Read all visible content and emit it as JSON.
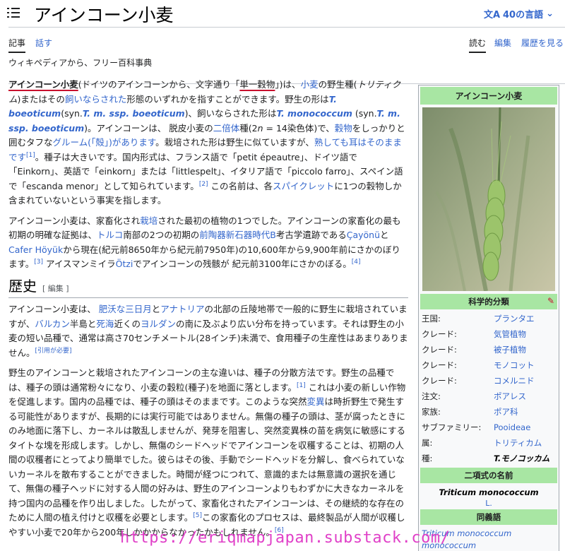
{
  "header": {
    "title": "アインコーン小麦",
    "lang_label": "40の言語",
    "lang_icon": "translate-icon"
  },
  "tabs": {
    "article": "記事",
    "talk": "話す",
    "read": "読む",
    "edit": "編集",
    "history": "履歴を見る"
  },
  "tagline": "ウィキペディアから、フリー百科事典",
  "intro": {
    "p1": [
      {
        "t": "アインコーン小麦",
        "s": "bold-red"
      },
      {
        "t": "(ドイツのアインコーンから、文字通り「"
      },
      {
        "t": "単一穀物",
        "s": "red"
      },
      {
        "t": "」)は、"
      },
      {
        "t": "小麦",
        "s": "link"
      },
      {
        "t": "の野生種("
      },
      {
        "t": "トリティクム",
        "s": "ital"
      },
      {
        "t": ")またはその"
      },
      {
        "t": "飼いならされた",
        "s": "link"
      },
      {
        "t": "形態のいずれかを指すことができます。野生の形は"
      },
      {
        "t": "T. boeoticum",
        "s": "bl"
      },
      {
        "t": "(syn."
      },
      {
        "t": "T. m. ssp. boeoticum",
        "s": "bl"
      },
      {
        "t": ")、飼いならされた形は"
      },
      {
        "t": "T. monococcum",
        "s": "bl"
      },
      {
        "t": " (syn."
      },
      {
        "t": "T. m. ssp. boeoticum",
        "s": "bl"
      },
      {
        "t": ")。アインコーンは、 脱皮小麦の"
      },
      {
        "t": "二倍体",
        "s": "link"
      },
      {
        "t": "種(2"
      },
      {
        "t": "n",
        "s": "ital"
      },
      {
        "t": " = 14染色体)で、"
      },
      {
        "t": "穀物",
        "s": "link"
      },
      {
        "t": "をしっかりと囲むタフな"
      },
      {
        "t": "グルーム(「殻」)があります",
        "s": "link"
      },
      {
        "t": "。栽培された形は野生に似ていますが、"
      },
      {
        "t": "熟しても耳はそのままです",
        "s": "link"
      },
      {
        "t": "[1]",
        "s": "sup"
      },
      {
        "t": "。種子は大きいです。国内形式は、フランス語で「petit épeautre」、ドイツ語で「Einkorn」、英語で「einkorn」または「littlespelt」、イタリア語で「piccolo farro」、スペイン語で「escanda menor」として知られています。"
      },
      {
        "t": "[2]",
        "s": "sup"
      },
      {
        "t": " この名前は、各"
      },
      {
        "t": "スパイクレット",
        "s": "link"
      },
      {
        "t": "に1つの穀物しか含まれていないという事実を指します。"
      }
    ],
    "p2": [
      {
        "t": "アインコーン小麦は、家畜化され"
      },
      {
        "t": "栽培",
        "s": "link"
      },
      {
        "t": "された最初の植物の1つでした。アインコーンの家畜化の最も初期の明確な証拠は、"
      },
      {
        "t": "トルコ",
        "s": "link"
      },
      {
        "t": "南部の2つの初期の"
      },
      {
        "t": "前陶器新石器時代B",
        "s": "link"
      },
      {
        "t": "考古学遺跡である"
      },
      {
        "t": "Çayönü",
        "s": "link"
      },
      {
        "t": "と"
      },
      {
        "t": "Cafer Höyük",
        "s": "link"
      },
      {
        "t": "から現在(紀元前8650年から紀元前7950年)の10,600年から9,900年前にさかのぼります。"
      },
      {
        "t": "[3]",
        "s": "sup"
      },
      {
        "t": " アイスマンミイラ"
      },
      {
        "t": "Ötzi",
        "s": "link"
      },
      {
        "t": "でアインコーンの残骸が 紀元前3100年にさかのぼる。"
      },
      {
        "t": "[4]",
        "s": "sup"
      }
    ]
  },
  "history": {
    "heading": "歴史",
    "edit_label": "[ 編集 ]",
    "p1": [
      {
        "t": "アインコーン小麦は、 "
      },
      {
        "t": "肥沃な三日月",
        "s": "link"
      },
      {
        "t": "と"
      },
      {
        "t": "アナトリア",
        "s": "link"
      },
      {
        "t": "の北部の丘陵地帯で一般的に野生に栽培されていますが、"
      },
      {
        "t": "バルカン",
        "s": "link"
      },
      {
        "t": "半島と"
      },
      {
        "t": "死海",
        "s": "link"
      },
      {
        "t": "近くの"
      },
      {
        "t": "ヨルダン",
        "s": "link"
      },
      {
        "t": "の南に及ぶより広い分布を持っています。それは野生の小麦の短い品種で、通常は高さ70センチメートル(28インチ)未満で、食用種子の生産性はあまりありません。"
      },
      {
        "t": "[引用が必要]",
        "s": "sup"
      }
    ],
    "p2": [
      {
        "t": "野生のアインコーンと栽培されたアインコーンの主な違いは、種子の分散方法です。野生の品種では、種子の頭は通常粉々になり、小麦の穀粒(種子)を地面に落とします。"
      },
      {
        "t": "[1]",
        "s": "sup"
      },
      {
        "t": " これは小麦の新しい作物を促進します。国内の品種では、種子の頭はそのままです。このような突然"
      },
      {
        "t": "変異",
        "s": "link"
      },
      {
        "t": "は時折野生で発生する可能性がありますが、長期的には実行可能ではありません。無傷の種子の頭は、茎が腐ったときにのみ地面に落下し、カーネルは散乱しませんが、発芽を阻害し、突然変異株の苗を病気に敏感にするタイトな塊を形成します。しかし、無傷のシードヘッドでアインコーンを収穫することは、初期の人間の収穫者にとってより簡単でした。彼らはその後、手動でシードヘッドを分解し、食べられていないカーネルを散布することができました。時間が経つにつれて、意識的または無意識の選択を通じて、無傷の種子ヘッドに対する人間の好みは、野生のアインコーンよりもわずかに大きなカーネルを持つ国内の品種を作り出しました。したがって、家畜化されたアインコーンは、その継続的な存在のために人間の植え付けと収穫を必要とします。"
      },
      {
        "t": "[5]",
        "s": "sup"
      },
      {
        "t": "この家畜化のプロセスは、最終製品が人間が収穫しやすい小麦で20年から200年しかかからなかったかもしれません。"
      },
      {
        "t": "[6]",
        "s": "sup"
      }
    ]
  },
  "infobox": {
    "title": "アインコーン小麦",
    "taxonomy_heading": "科学的分類",
    "rows": [
      {
        "k": "王国:",
        "v": "プランタエ"
      },
      {
        "k": "クレード:",
        "v": "気管植物"
      },
      {
        "k": "クレード:",
        "v": "被子植物"
      },
      {
        "k": "クレード:",
        "v": "モノコット"
      },
      {
        "k": "クレード:",
        "v": "コメルニド"
      },
      {
        "k": "注文:",
        "v": "ポアレス"
      },
      {
        "k": "家族:",
        "v": "ポア科"
      },
      {
        "k": "サブファミリー:",
        "v": "Pooideae"
      },
      {
        "k": "属:",
        "v": "トリティカム"
      },
      {
        "k": "種:",
        "v": "T.モノコッカム",
        "bold": true
      }
    ],
    "binomial_heading": "二項式の名前",
    "binomial": "Triticum monococcum",
    "binomial_author": "L.",
    "synonyms_heading": "同義語",
    "synonyms": [
      "Triticum monococcum",
      "monococcum"
    ]
  },
  "watermark": "https://eriqmapjapan.substack.com/",
  "colors": {
    "link": "#3366cc",
    "infobox_header": "#a8e6a3",
    "annotation_red": "#c8102e",
    "watermark": "#e040c8"
  }
}
